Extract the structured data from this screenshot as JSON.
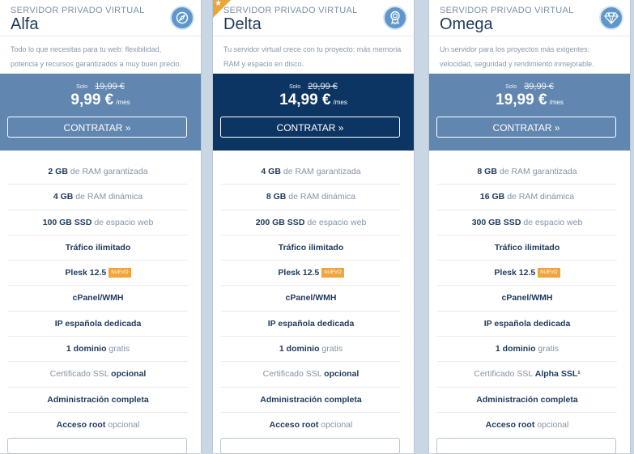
{
  "plans": [
    {
      "kicker": "SERVIDOR PRIVADO VIRTUAL",
      "name": "Alfa",
      "icon": "compass-icon",
      "featured": false,
      "description": "Todo lo que necesitas para tu web: flexibilidad, potencia y recursos garantizados a muy buen precio.",
      "solo_label": "Solo",
      "old_price": "19,99 €",
      "price": "9,99 €",
      "per": "/mes",
      "cta": "CONTRATAR »",
      "band_color": "#6186b0",
      "features": [
        {
          "strong": "2 GB",
          "rest": " de RAM garantizada"
        },
        {
          "strong": "4 GB",
          "rest": " de RAM dinámica"
        },
        {
          "strong": "100 GB SSD",
          "rest": " de espacio web"
        },
        {
          "strong": "Tráfico ilimitado",
          "rest": ""
        },
        {
          "strong": "Plesk 12.5",
          "rest": "",
          "badge": "NUEVO"
        },
        {
          "strong": "cPanel/WMH",
          "rest": ""
        },
        {
          "strong": "IP española dedicada",
          "rest": ""
        },
        {
          "strong": "1 dominio",
          "rest": " gratis"
        },
        {
          "pre": "Certificado SSL ",
          "strong": "opcional",
          "rest": ""
        },
        {
          "strong": "Administración completa",
          "rest": ""
        },
        {
          "strong": "Acceso root",
          "rest": " opcional"
        }
      ]
    },
    {
      "kicker": "SERVIDOR PRIVADO VIRTUAL",
      "name": "Delta",
      "icon": "award-ribbon-icon",
      "featured": true,
      "description": "Tu servidor virtual crece con tu proyecto: más memoria RAM y espacio en disco.",
      "solo_label": "Solo",
      "old_price": "29,99 €",
      "price": "14,99 €",
      "per": "/mes",
      "cta": "CONTRATAR »",
      "band_color": "#0d3563",
      "features": [
        {
          "strong": "4 GB",
          "rest": " de RAM garantizada"
        },
        {
          "strong": "8 GB",
          "rest": " de RAM dinámica"
        },
        {
          "strong": "200 GB SSD",
          "rest": " de espacio web"
        },
        {
          "strong": "Tráfico ilimitado",
          "rest": ""
        },
        {
          "strong": "Plesk 12.5",
          "rest": "",
          "badge": "NUEVO"
        },
        {
          "strong": "cPanel/WMH",
          "rest": ""
        },
        {
          "strong": "IP española dedicada",
          "rest": ""
        },
        {
          "strong": "1 dominio",
          "rest": " gratis"
        },
        {
          "pre": "Certificado SSL ",
          "strong": "opcional",
          "rest": ""
        },
        {
          "strong": "Administración completa",
          "rest": ""
        },
        {
          "strong": "Acceso root",
          "rest": " opcional"
        }
      ]
    },
    {
      "kicker": "SERVIDOR PRIVADO VIRTUAL",
      "name": "Omega",
      "icon": "diamond-icon",
      "featured": false,
      "description": "Un servidor para los proyectos más exigentes: velocidad, seguridad y rendimiento inmejorable.",
      "solo_label": "Solo",
      "old_price": "39,99 €",
      "price": "19,99 €",
      "per": "/mes",
      "cta": "CONTRATAR »",
      "band_color": "#6186b0",
      "features": [
        {
          "strong": "8 GB",
          "rest": " de RAM garantizada"
        },
        {
          "strong": "16 GB",
          "rest": " de RAM dinámica"
        },
        {
          "strong": "300 GB SSD",
          "rest": " de espacio web"
        },
        {
          "strong": "Tráfico ilimitado",
          "rest": ""
        },
        {
          "strong": "Plesk 12.5",
          "rest": "",
          "badge": "NUEVO"
        },
        {
          "strong": "cPanel/WMH",
          "rest": ""
        },
        {
          "strong": "IP española dedicada",
          "rest": ""
        },
        {
          "strong": "1 dominio",
          "rest": " gratis"
        },
        {
          "pre": "Certificado SSL ",
          "strong": "Alpha SSL¹",
          "rest": ""
        },
        {
          "strong": "Administración completa",
          "rest": ""
        },
        {
          "strong": "Acceso root",
          "rest": " opcional"
        }
      ]
    }
  ]
}
